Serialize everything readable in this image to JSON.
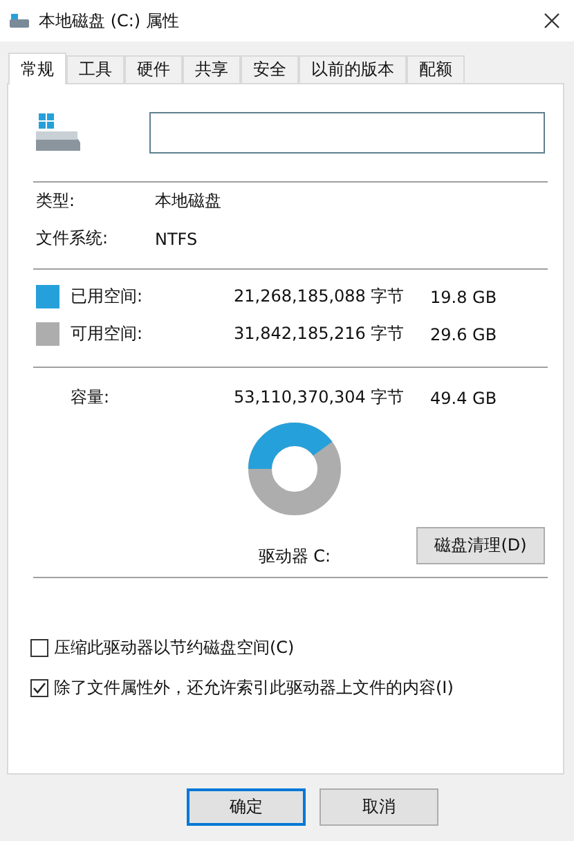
{
  "window": {
    "title": "本地磁盘 (C:) 属性"
  },
  "tabs": [
    {
      "label": "常规",
      "selected": true
    },
    {
      "label": "工具",
      "selected": false
    },
    {
      "label": "硬件",
      "selected": false
    },
    {
      "label": "共享",
      "selected": false
    },
    {
      "label": "安全",
      "selected": false
    },
    {
      "label": "以前的版本",
      "selected": false
    },
    {
      "label": "配额",
      "selected": false
    }
  ],
  "info": [
    {
      "label": "类型:",
      "value": "本地磁盘"
    },
    {
      "label": "文件系统:",
      "value": "NTFS"
    }
  ],
  "space": [
    {
      "label": "已用空间:",
      "bytes": "21,268,185,088 字节",
      "size": "19.8 GB",
      "color": "#26a0da"
    },
    {
      "label": "可用空间:",
      "bytes": "31,842,185,216 字节",
      "size": "29.6 GB",
      "color": "#adadad"
    }
  ],
  "capacity": {
    "label": "容量:",
    "bytes": "53,110,370,304 字节",
    "size": "49.4 GB",
    "level": 0.4
  },
  "drive_label": "驱动器 C:",
  "cleanup_button": "磁盘清理(D)",
  "options": [
    {
      "label": "压缩此驱动器以节约磁盘空间(C)",
      "checked": false
    },
    {
      "label": "除了文件属性外，还允许索引此驱动器上文件的内容(I)",
      "checked": true
    }
  ],
  "buttons": [
    {
      "label": "确定",
      "default": true
    },
    {
      "label": "取消",
      "default": false
    }
  ]
}
